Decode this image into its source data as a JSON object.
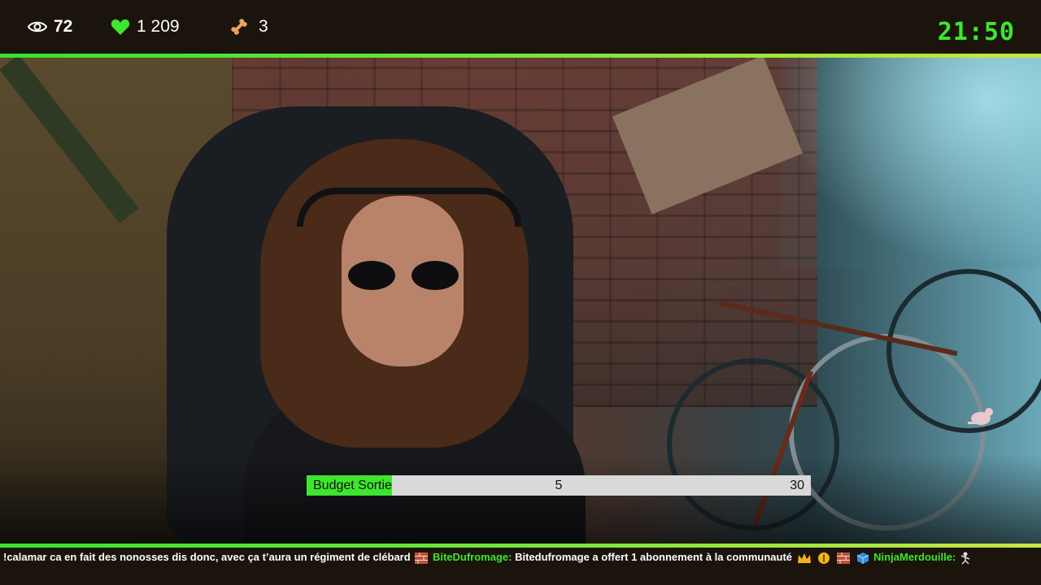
{
  "header": {
    "viewers": "72",
    "likes": "1 209",
    "bones": "3",
    "clock": "21:50"
  },
  "budget": {
    "label": "Budget Sortie",
    "current": "5",
    "max": "30",
    "fraction": 0.17
  },
  "ticker": {
    "msg1_text": "!calamar ca en fait des nonosses dis donc, avec ça t’aura un régiment de clébard",
    "msg2_user": "BiteDufromage:",
    "msg2_text": "Bitedufromage a offert 1 abonnement à la communauté",
    "msg3_user": "NinjaMerdouille:"
  },
  "colors": {
    "accent_green": "#3ee62f",
    "bar_bg": "#1b140c"
  },
  "icons": [
    "eye-icon",
    "heart-icon",
    "bone-icon",
    "crown-icon",
    "coin-icon",
    "brick-icon",
    "cube-icon"
  ]
}
